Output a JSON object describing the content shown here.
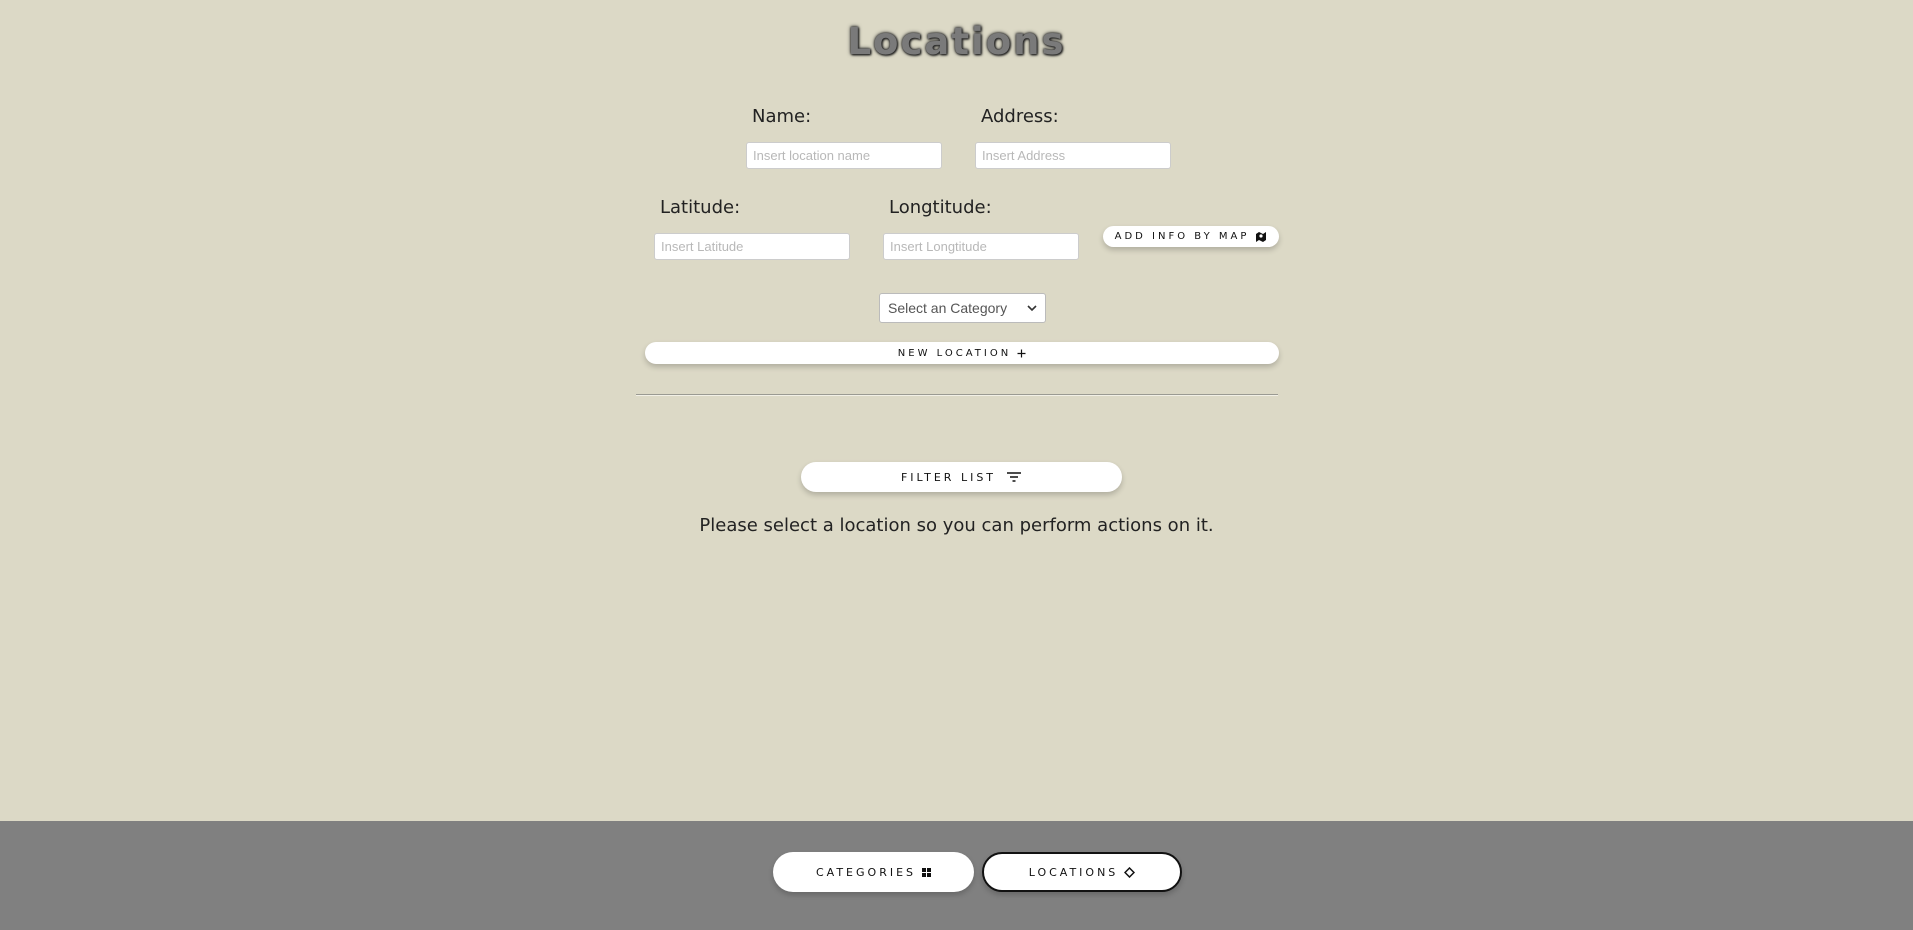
{
  "page": {
    "title": "Locations"
  },
  "form": {
    "name_label": "Name:",
    "name_placeholder": "Insert location name",
    "address_label": "Address:",
    "address_placeholder": "Insert Address",
    "latitude_label": "Latitude:",
    "latitude_placeholder": "Insert Latitude",
    "longitude_label": "Longtitude:",
    "longitude_placeholder": "Insert Longtitude",
    "add_by_map_label": "ADD INFO BY MAP",
    "category_select_value": "Select an Category",
    "new_location_label": "NEW LOCATION"
  },
  "list": {
    "filter_label": "FILTER LIST",
    "empty_message": "Please select a location so you can perform actions on it."
  },
  "footer": {
    "categories_label": "CATEGORIES",
    "locations_label": "LOCATIONS",
    "active": "locations"
  },
  "colors": {
    "background": "#dcd9c6",
    "footer": "#808080",
    "button": "#ffffff"
  },
  "icons": {
    "add_by_map": "map-icon",
    "new_location": "plus-icon",
    "filter": "filter-icon",
    "categories": "grid-icon",
    "locations": "diamond-icon",
    "select": "chevron-down-icon"
  }
}
